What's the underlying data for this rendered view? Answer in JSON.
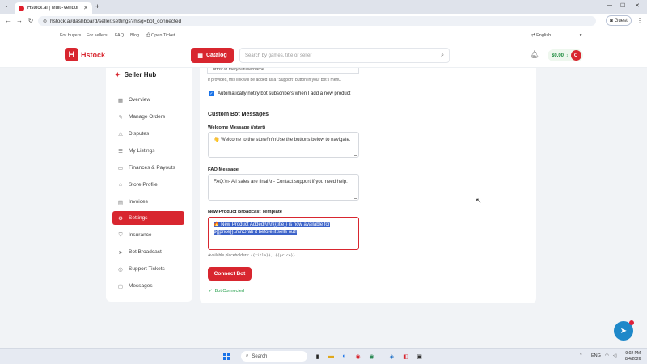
{
  "browser": {
    "tab_title": "Hstock.ai | Multi-Vendor Digital",
    "url": "hstock.ai/dashboard/seller/settings?msg=bot_connected",
    "guest_label": "Guest"
  },
  "toplinks": {
    "for_buyers": "For buyers",
    "for_sellers": "For sellers",
    "faq": "FAQ",
    "blog": "Blog",
    "open_ticket": "Open Ticket",
    "language": "English"
  },
  "header": {
    "logo_text": "Hstock",
    "catalog_label": "Catalog",
    "search_placeholder": "Search by games, title or seller",
    "balance": "$0.00",
    "avatar_letter": "C"
  },
  "sidebar": {
    "title": "Seller Hub",
    "items": [
      {
        "label": "Overview",
        "icon": "grid-icon"
      },
      {
        "label": "Manage Orders",
        "icon": "pencil-icon"
      },
      {
        "label": "Disputes",
        "icon": "warning-icon"
      },
      {
        "label": "My Listings",
        "icon": "list-icon"
      },
      {
        "label": "Finances & Payouts",
        "icon": "wallet-icon"
      },
      {
        "label": "Store Profile",
        "icon": "store-icon"
      },
      {
        "label": "Invoices",
        "icon": "invoice-icon"
      },
      {
        "label": "Settings",
        "icon": "gear-icon",
        "active": true
      },
      {
        "label": "Insurance",
        "icon": "shield-icon"
      },
      {
        "label": "Bot Broadcast",
        "icon": "broadcast-icon"
      },
      {
        "label": "Support Tickets",
        "icon": "ticket-icon"
      },
      {
        "label": "Messages",
        "icon": "chat-icon"
      }
    ]
  },
  "settings": {
    "support_url_value": "https://t.me/yourusername",
    "support_hint": "If provided, this link will be added as a \"Support\" button in your bot's menu.",
    "auto_notify_label": "Automatically notify bot subscribers when I add a new product",
    "auto_notify_checked": true,
    "section_title": "Custom Bot Messages",
    "welcome_label": "Welcome Message (/start)",
    "welcome_value": "👋 Welcome to the store!\\n\\nUse the buttons below to navigate.",
    "faq_label": "FAQ Message",
    "faq_value": "FAQ:\\n- All sales are final.\\n- Contact support if you need help.",
    "broadcast_label": "New Product Broadcast Template",
    "broadcast_value_line1": "🔥 New Product Added!\\n\\n{{title}} is now available for",
    "broadcast_value_line2": "${{price}}.\\n\\nGrab it before it sells out!",
    "placeholders_label": "Available placeholders:",
    "placeholders_values": "{{title}}, {{price}}",
    "connect_label": "Connect Bot",
    "status_text": "Bot Connected"
  },
  "taskbar": {
    "search_label": "Search",
    "lang": "ENG",
    "time": "9:02 PM",
    "date": "8/4/2026"
  },
  "colors": {
    "brand_red": "#d8262f",
    "success_green": "#1f9d47",
    "selection_blue": "#3b62c9"
  }
}
